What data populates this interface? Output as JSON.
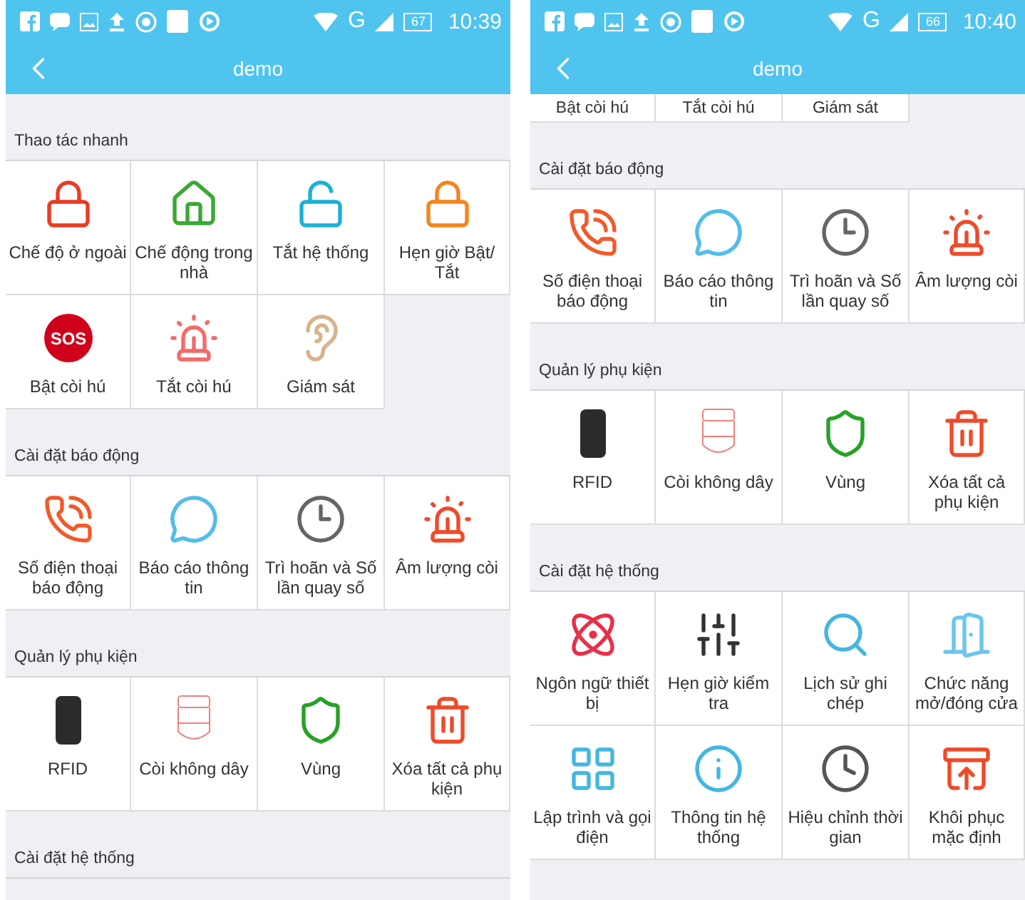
{
  "screens": [
    {
      "status_bar": {
        "network": "G",
        "battery": "67",
        "time": "10:39"
      },
      "title": "demo",
      "sections": [
        {
          "kind": "full",
          "title": "Thao tác nhanh",
          "items": [
            {
              "kind": "lock",
              "label": "Chế độ ở ngoài"
            },
            {
              "kind": "home",
              "label": "Chế động trong nhà"
            },
            {
              "kind": "unlock",
              "label": "Tắt hệ thống"
            },
            {
              "kind": "timer_lock",
              "label": "Hẹn giờ Bật/ Tắt"
            },
            {
              "kind": "sos",
              "label": "Bật còi hú",
              "icon_text": "SOS"
            },
            {
              "kind": "siren_off",
              "label": "Tắt còi hú"
            },
            {
              "kind": "ear",
              "label": "Giám sát"
            }
          ]
        },
        {
          "kind": "full",
          "title": "Cài đặt báo động",
          "items": [
            {
              "kind": "phone",
              "label": "Số điện thoại báo động"
            },
            {
              "kind": "chat",
              "label": "Báo cáo thông tin"
            },
            {
              "kind": "clock",
              "label": "Trì hoãn và Số lần quay số"
            },
            {
              "kind": "beacon",
              "label": "Âm lượng còi"
            }
          ]
        },
        {
          "kind": "full",
          "title": "Quản lý phụ kiện",
          "items": [
            {
              "kind": "rfid",
              "label": "RFID"
            },
            {
              "kind": "sensor",
              "label": "Còi không dây"
            },
            {
              "kind": "shield",
              "label": "Vùng"
            },
            {
              "kind": "trash",
              "label": "Xóa tất cả phụ kiện"
            }
          ]
        },
        {
          "kind": "full",
          "title": "Cài đặt hệ thống"
        }
      ]
    },
    {
      "status_bar": {
        "network": "G",
        "battery": "66",
        "time": "10:40"
      },
      "title": "demo",
      "sections": [
        {
          "kind": "tail",
          "items": [
            {
              "label": "Bật còi hú"
            },
            {
              "label": "Tắt còi hú"
            },
            {
              "label": "Giám sát"
            }
          ]
        },
        {
          "kind": "full",
          "title": "Cài đặt báo động",
          "items": [
            {
              "kind": "phone",
              "label": "Số điện thoại báo động"
            },
            {
              "kind": "chat",
              "label": "Báo cáo thông tin"
            },
            {
              "kind": "clock",
              "label": "Trì hoãn và Số lần quay số"
            },
            {
              "kind": "beacon",
              "label": "Âm lượng còi"
            }
          ]
        },
        {
          "kind": "full",
          "title": "Quản lý phụ kiện",
          "items": [
            {
              "kind": "rfid",
              "label": "RFID"
            },
            {
              "kind": "sensor",
              "label": "Còi không dây"
            },
            {
              "kind": "shield",
              "label": "Vùng"
            },
            {
              "kind": "trash",
              "label": "Xóa tất cả phụ kiện"
            }
          ]
        },
        {
          "kind": "full",
          "title": "Cài đặt hệ thống",
          "items": [
            {
              "kind": "atom",
              "label": "Ngôn ngữ thiết bị"
            },
            {
              "kind": "sliders",
              "label": "Hẹn giờ kiểm tra"
            },
            {
              "kind": "search",
              "label": "Lịch sử ghi chép"
            },
            {
              "kind": "door",
              "label": "Chức năng mở/đóng cửa"
            },
            {
              "kind": "grid",
              "label": "Lập trình và gọi điện"
            },
            {
              "kind": "info",
              "label": "Thông tin hệ thống"
            },
            {
              "kind": "wall_clock",
              "label": "Hiệu chỉnh thời gian"
            },
            {
              "kind": "restore",
              "label": "Khôi phục mặc định"
            }
          ]
        }
      ]
    }
  ]
}
